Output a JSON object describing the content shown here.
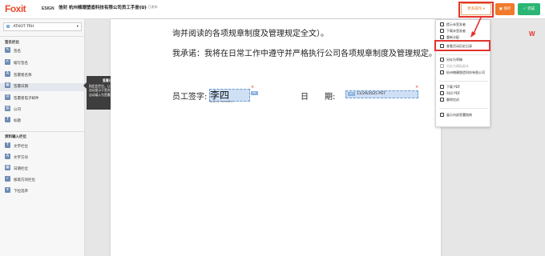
{
  "topbar": {
    "logo": "Foxit",
    "logo_sub": "ESIGN",
    "doc_title": "信封 杭州楠珊塑造科技有限公司员工手册(1)",
    "doc_status": "编辑: 已发布",
    "more_button": "更多操作 ▾",
    "save_button": "▣ 保存",
    "done_button": "✓ 完成"
  },
  "sidebar": {
    "signer": "ATHOT TRH",
    "signature_section": "签名栏位",
    "signature_items": [
      {
        "icon": "sign-icon",
        "label": "签名"
      },
      {
        "icon": "initials-icon",
        "label": "缩写签名"
      },
      {
        "icon": "signer-name-icon",
        "label": "签署者名称"
      },
      {
        "icon": "date-icon",
        "label": "签署日期"
      },
      {
        "icon": "email-icon",
        "label": "签署者电子邮件"
      },
      {
        "icon": "company-icon",
        "label": "公司"
      },
      {
        "icon": "title-icon",
        "label": "标题"
      }
    ],
    "input_section": "资料输入栏位",
    "input_items": [
      {
        "icon": "text-field-icon",
        "label": "文字栏位"
      },
      {
        "icon": "textbox-icon",
        "label": "文字方块"
      },
      {
        "icon": "date-field-icon",
        "label": "日期栏位"
      },
      {
        "icon": "checkbox-icon",
        "label": "核取方块栏位"
      },
      {
        "icon": "dropdown-icon",
        "label": "下拉选单"
      }
    ]
  },
  "tooltip": {
    "title": "签署日期栏位",
    "body": "指定此栏位，让签署者签名日期可自动显示于签名时日期。此日期将自动填入为签署的日期。"
  },
  "document": {
    "line1": "询并阅读的各项规章制度及管理规定全文）。",
    "line2": "我承诺：我将在日常工作中遵守并严格执行公司各项规章制度及管理规定。",
    "sign_label": "员工签字:",
    "signer_name": "李四",
    "sig_caption": "Signed by: FOOCHEN & ...",
    "sig_tag": "NT",
    "date_label": "日　　期:",
    "date_tag": "NT",
    "date_value": "11/29/2025 PST"
  },
  "menu": {
    "items": [
      {
        "icon": "remind-icon",
        "label": "提示未签发者",
        "disabled": false
      },
      {
        "icon": "download-icon",
        "label": "下载未签发者",
        "disabled": false
      },
      {
        "icon": "reassign-icon",
        "label": "重新分配",
        "disabled": false
      },
      {
        "icon": "history-icon",
        "label": "查看活动历史记录",
        "disabled": false
      },
      {
        "icon": "save-draft-icon",
        "label": "另存为草稿",
        "disabled": false
      },
      {
        "icon": "save-template-icon",
        "label": "另存为模板副本",
        "disabled": true
      },
      {
        "icon": "copy-icon",
        "label": "杭州楠珊塑造科技有限公司",
        "disabled": false
      },
      {
        "icon": "pdf-icon",
        "label": "下载 PDF",
        "disabled": false
      },
      {
        "icon": "print-icon",
        "label": "列印 PDF",
        "disabled": false
      },
      {
        "icon": "delete-icon",
        "label": "删除信封",
        "disabled": false
      },
      {
        "icon": "guide-icon",
        "label": "展示内部签署指南",
        "disabled": false
      }
    ]
  },
  "colors": {
    "accent": "#e3342f",
    "save": "#f07a2b",
    "done": "#2bb673",
    "field_fill": "#cfe0f5"
  }
}
